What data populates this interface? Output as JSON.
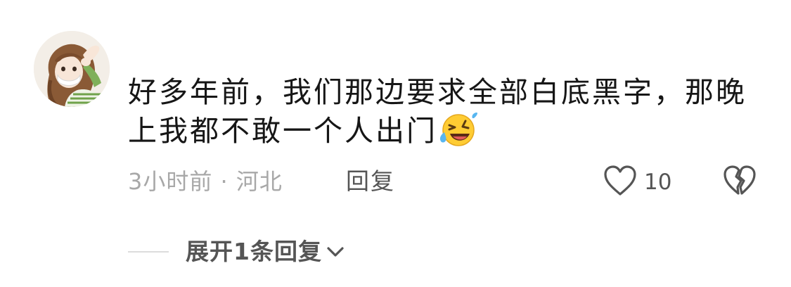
{
  "comment": {
    "avatar_icon": "user-avatar-illustration",
    "text": "好多年前，我们那边要求全部白底黑字，那晚上我都不敢一个人出门",
    "emoji_icon": "rolling-on-floor-laughing-emoji",
    "time": "3小时前",
    "separator": "·",
    "location": "河北",
    "reply_label": "回复",
    "like_icon": "heart-outline-icon",
    "like_count": "10",
    "dislike_icon": "broken-heart-icon"
  },
  "replies": {
    "expand_label": "展开1条回复",
    "chevron_icon": "chevron-down-icon"
  },
  "colors": {
    "text_primary": "#161616",
    "text_secondary": "#a8a8a8",
    "text_action": "#555555"
  }
}
